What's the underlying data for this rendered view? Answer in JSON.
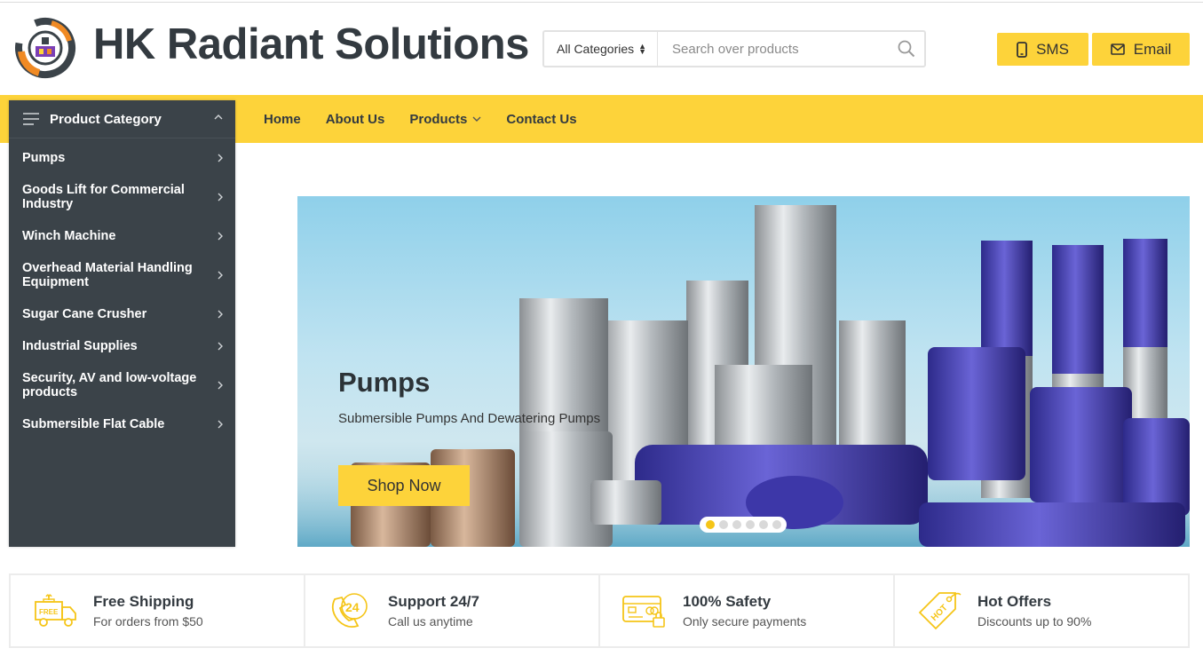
{
  "header": {
    "brand": "HK Radiant Solutions",
    "search": {
      "category_selected": "All Categories",
      "placeholder": "Search over products"
    },
    "buttons": {
      "sms": "SMS",
      "email": "Email"
    }
  },
  "nav": {
    "items": [
      {
        "label": "Home"
      },
      {
        "label": "About Us"
      },
      {
        "label": "Products",
        "dropdown": true
      },
      {
        "label": "Contact Us"
      }
    ]
  },
  "sidebar": {
    "title": "Product Category",
    "items": [
      {
        "label": "Pumps"
      },
      {
        "label": "Goods Lift for Commercial Industry"
      },
      {
        "label": "Winch Machine"
      },
      {
        "label": "Overhead Material Handling Equipment"
      },
      {
        "label": "Sugar Cane Crusher"
      },
      {
        "label": "Industrial Supplies"
      },
      {
        "label": "Security, AV and low-voltage products"
      },
      {
        "label": "Submersible Flat Cable"
      }
    ]
  },
  "banner": {
    "title": "Pumps",
    "subtitle": "Submersible Pumps And Dewatering Pumps",
    "cta": "Shop Now",
    "slide_count": 6,
    "active_slide": 1
  },
  "features": [
    {
      "icon": "free-shipping-truck-icon",
      "title": "Free Shipping",
      "subtitle": "For orders from $50"
    },
    {
      "icon": "support-24-7-icon",
      "title": "Support 24/7",
      "subtitle": "Call us anytime"
    },
    {
      "icon": "secure-payment-card-icon",
      "title": "100% Safety",
      "subtitle": "Only secure payments"
    },
    {
      "icon": "hot-offer-tag-icon",
      "title": "Hot Offers",
      "subtitle": "Discounts up to 90%"
    }
  ],
  "colors": {
    "accent": "#fdd33a",
    "sidebar_bg": "#3b4349",
    "text_dark": "#333a40",
    "logo_orange": "#f08a24",
    "logo_purple": "#7b3fb5"
  }
}
